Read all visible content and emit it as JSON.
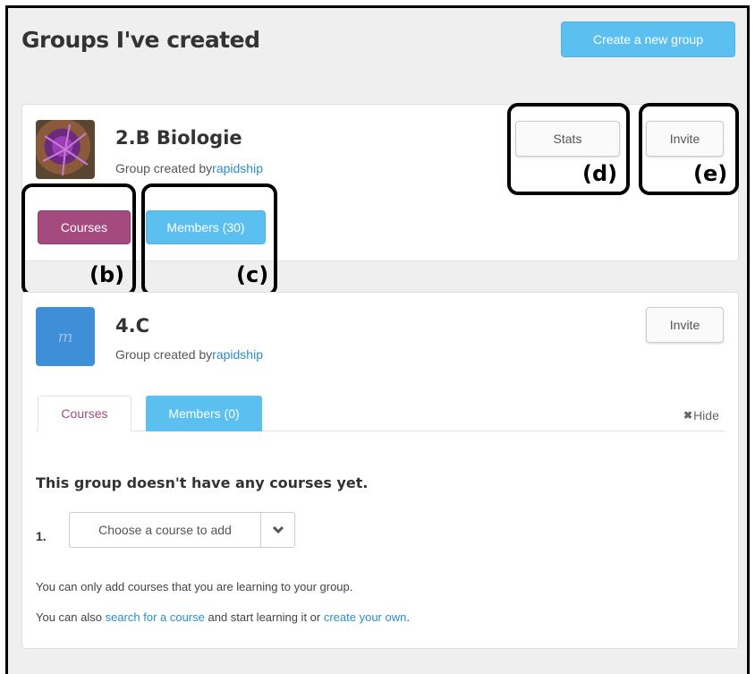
{
  "page": {
    "title": "Groups I've created",
    "create_button": "Create a new group"
  },
  "groups": [
    {
      "name": "2.B Biologie",
      "created_by_prefix": "Group created by",
      "creator": "rapidship",
      "buttons": {
        "stats": "Stats",
        "invite": "Invite",
        "courses": "Courses",
        "members": "Members (30)"
      }
    },
    {
      "name": "4.C",
      "avatar_letter": "m",
      "created_by_prefix": "Group created by",
      "creator": "rapidship",
      "buttons": {
        "invite": "Invite"
      },
      "tabs": {
        "courses": "Courses",
        "members": "Members (0)"
      },
      "hide_label": "Hide",
      "empty_message": "This group doesn't have any courses yet.",
      "course_row_number": "1.",
      "course_select_placeholder": "Choose a course to add",
      "note1": "You can only add courses that you are learning to your group.",
      "note2_prefix": "You can also ",
      "note2_link1": "search for a course",
      "note2_mid": " and start learning it or ",
      "note2_link2": "create your own",
      "note2_suffix": "."
    }
  ],
  "callouts": {
    "b": "(b)",
    "c": "(c)",
    "d": "(d)",
    "e": "(e)"
  },
  "colors": {
    "accent_blue": "#5bc0ef",
    "courses_magenta": "#a54a7f",
    "link_blue": "#2a8fc9"
  }
}
